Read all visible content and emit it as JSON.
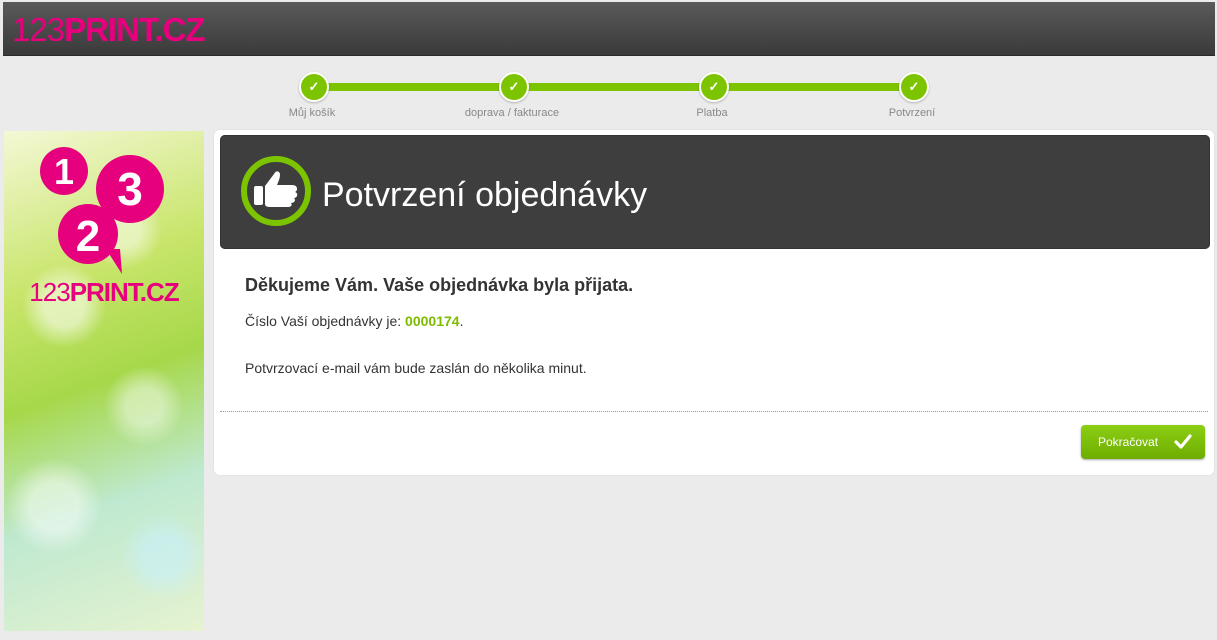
{
  "header": {
    "logo_num": "123",
    "logo_text": "PRINT.CZ"
  },
  "steps": [
    {
      "label": "Můj košík"
    },
    {
      "label": "doprava / fakturace"
    },
    {
      "label": "Platba"
    },
    {
      "label": "Potvrzení"
    }
  ],
  "banner": {
    "brand_num": "123",
    "brand_text": "PRINT.CZ"
  },
  "confirmation": {
    "title": "Potvrzení objednávky",
    "thanks": "Děkujeme Vám. Vaše objednávka byla přijata.",
    "order_prefix": "Číslo Vaší objednávky je: ",
    "order_number": "0000174",
    "order_suffix": ".",
    "email_note": "Potvrzovací e-mail vám bude zaslán do několika minut."
  },
  "actions": {
    "continue_label": "Pokračovat"
  },
  "colors": {
    "brand": "#e6007e",
    "accent": "#7dc400"
  }
}
